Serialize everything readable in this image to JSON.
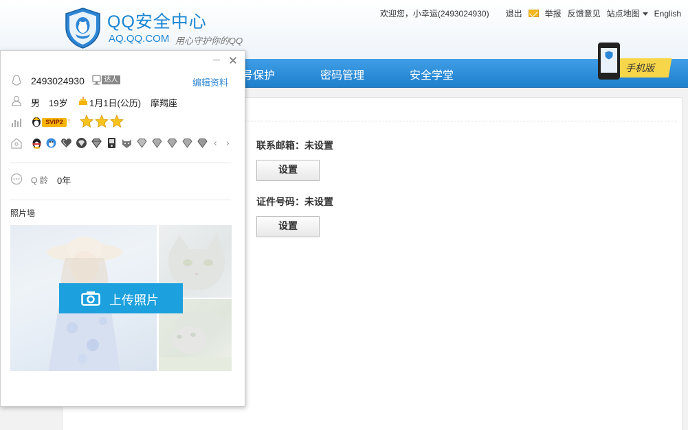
{
  "brand": {
    "title": "QQ安全中心",
    "domain": "AQ.QQ.COM",
    "slogan": "用心守护你的QQ",
    "accent": "#1b86d3"
  },
  "topbar": {
    "welcome": "欢迎您，小幸运(2493024930)",
    "logout": "退出",
    "report": "举报",
    "feedback": "反馈意见",
    "sitemap": "站点地图",
    "english": "English"
  },
  "nav": {
    "items": [
      "号保护",
      "密码管理",
      "安全学堂"
    ],
    "mobile_label": "手机版"
  },
  "security": {
    "email_label": "联系邮箱：未设置",
    "email_button": "设置",
    "id_label": "证件号码：未设置",
    "id_button": "设置"
  },
  "profile": {
    "qq_number": "2493024930",
    "daren_tag": "达人",
    "edit_link": "编辑资料",
    "gender": "男",
    "age": "19岁",
    "birthday": "1月1日(公历)",
    "zodiac": "摩羯座",
    "svip_label": "SVIP2",
    "star_count": 3,
    "qage_label": "Q 龄",
    "qage_value": "0年",
    "photo_wall_label": "照片墙",
    "upload_button": "上传照片",
    "colors": {
      "link": "#2f86d1",
      "upload": "#1ca0de",
      "svip": "#f5b400"
    }
  }
}
